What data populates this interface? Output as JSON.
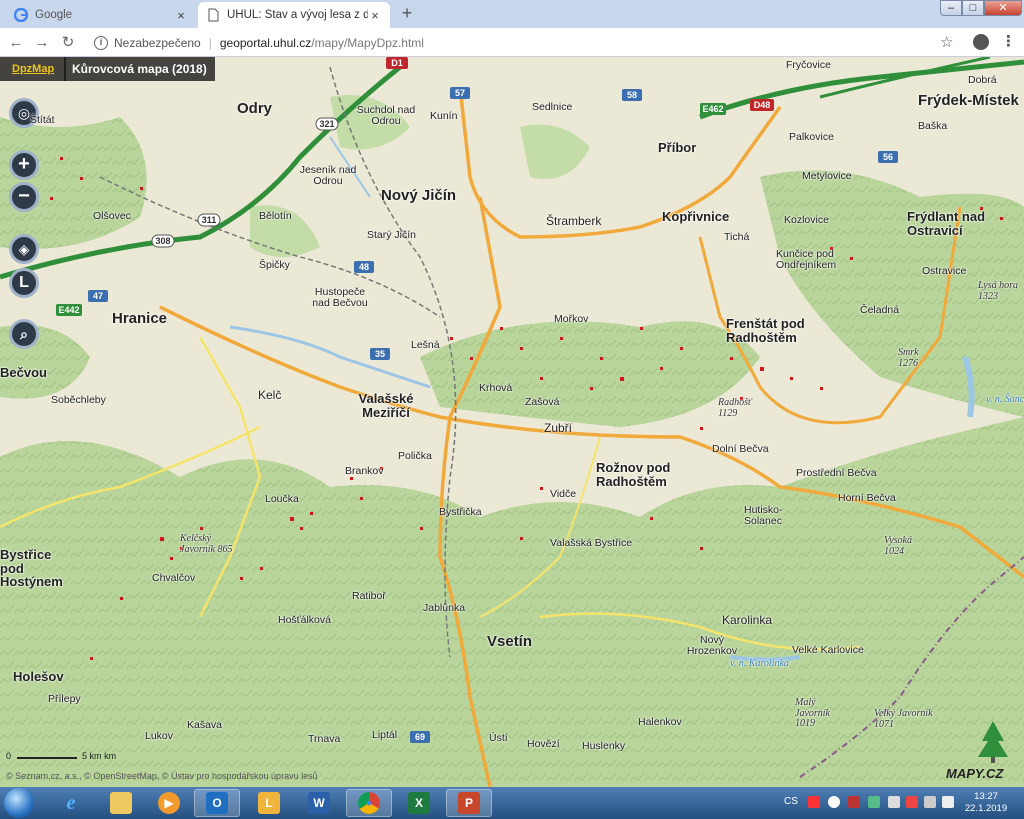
{
  "browser": {
    "tabs": [
      {
        "title": "Google",
        "close": "×"
      },
      {
        "title": "ÚHÚL: Stav a vývoj lesa z dálkového průzkumu",
        "close": "×"
      }
    ],
    "new_tab": "+",
    "window_controls": {
      "minimize": "–",
      "maximize": "□",
      "close": "✕"
    },
    "address": {
      "security_label": "Nezabezpečeno",
      "host": "geoportal.uhul.cz",
      "path": "/mapy/MapyDpz.html"
    }
  },
  "map": {
    "app_label": "DpzMap",
    "layer_title": "Kůrovcová mapa (2018)",
    "controls": {
      "zoom_in": "+",
      "zoom_out": "−",
      "layers": "layers",
      "legend": "L",
      "search": "search"
    },
    "places_large": [
      "Odry",
      "Nový Jičín",
      "Příbor",
      "Frýdek-Místek",
      "Kopřivnice",
      "Frýdlant nad Ostravicí",
      "Hranice",
      "Frenštát pod Radhoštěm",
      "Valašské Meziříčí",
      "Rožnov pod Radhoštěm",
      "Vsetín",
      "Bystřice pod Hostýnem",
      "Holešov",
      "Bečvou"
    ],
    "places_small": [
      "Fryčovice",
      "Dobrá",
      "Baška",
      "Sedlnice",
      "Suchdol nad Odrou",
      "Kunín",
      "Palkovice",
      "Metylovice",
      "Jeseník nad Odrou",
      "Štramberk",
      "Kozlovice",
      "Bělotín",
      "Starý Jičín",
      "Tichá",
      "Olšovec",
      "Kunčice pod Ondřejníkem",
      "Ostravice",
      "Špičky",
      "Hustopeče nad Bečvou",
      "Čeladná",
      "Mořkov",
      "Lešná",
      "Krhová",
      "Zašová",
      "Kelč",
      "Soběchleby",
      "Zubří",
      "Dolní Bečva",
      "Polička",
      "Prostřední Bečva",
      "Horní Bečva",
      "Vidče",
      "Bystřička",
      "Hutisko-Solanec",
      "Valašská Bystřice",
      "Loučka",
      "Chvalčov",
      "Ratiboř",
      "Jablůnka",
      "Hošťálková",
      "Karolinka",
      "Nový Hrozenkov",
      "Velké Karlovice",
      "Halenkov",
      "Lukov",
      "Přílepy",
      "Kašava",
      "Trnava",
      "Liptál",
      "Ústí",
      "Hovězí",
      "Huslenky",
      "Brankov",
      "Štítát"
    ],
    "peaks": [
      "Lysá hora 1323",
      "Smrk 1276",
      "Radhošť 1129",
      "Vysoká 1024",
      "Malý Javorník 1019",
      "Velký Javorník 1071",
      "Kelčský Javorník 865",
      "v. n. Karolinka",
      "v. n. Šance"
    ],
    "road_labels": [
      "D1",
      "57",
      "58",
      "E462",
      "D48",
      "56",
      "321",
      "311",
      "308",
      "48",
      "47",
      "E442",
      "35",
      "69"
    ],
    "scale": {
      "label": "5 km",
      "zero": "0",
      "unit": "km"
    },
    "attribution": [
      "Seznam.cz, a.s.",
      "OpenStreetMap",
      "Ústav pro hospodářskou úpravu lesů"
    ],
    "logo_text": "MAPY.CZ",
    "colors": {
      "forest": "#b6d39a",
      "lowland": "#ece8d6",
      "bark_beetle": "#d1161b",
      "motorway": "#2f8f3a",
      "road": "#f0a93a",
      "water": "#9cc6e6"
    }
  },
  "taskbar": {
    "apps": [
      {
        "name": "Internet Explorer",
        "glyph": "e"
      },
      {
        "name": "Explorer",
        "glyph": "📁"
      },
      {
        "name": "Media Player",
        "glyph": "▶"
      },
      {
        "name": "Outlook",
        "glyph": "O"
      },
      {
        "name": "Lync",
        "glyph": "L"
      },
      {
        "name": "Word",
        "glyph": "W"
      },
      {
        "name": "Chrome",
        "glyph": "●"
      },
      {
        "name": "Excel",
        "glyph": "X"
      },
      {
        "name": "PowerPoint",
        "glyph": "P"
      }
    ],
    "language": "CS",
    "time": "13:27",
    "date": "22.1.2019"
  }
}
